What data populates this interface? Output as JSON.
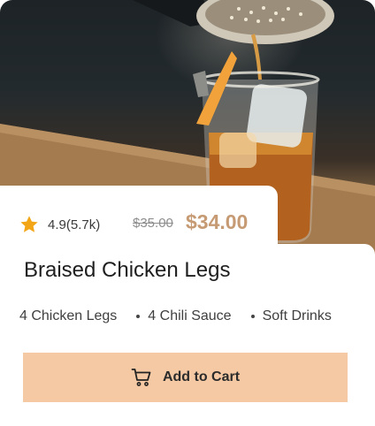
{
  "product": {
    "rating": "4.9(5.7k)",
    "old_price": "$35.00",
    "new_price": "$34.00",
    "title": "Braised Chicken Legs",
    "features": [
      "4 Chicken Legs",
      "4 Chili Sauce",
      "Soft Drinks"
    ]
  },
  "actions": {
    "add_to_cart_label": "Add to Cart"
  },
  "colors": {
    "accent": "#c69a73",
    "button_bg": "#f4c9a3",
    "star": "#f2a516"
  },
  "icons": {
    "rating": "star-icon",
    "cart": "cart-icon"
  }
}
